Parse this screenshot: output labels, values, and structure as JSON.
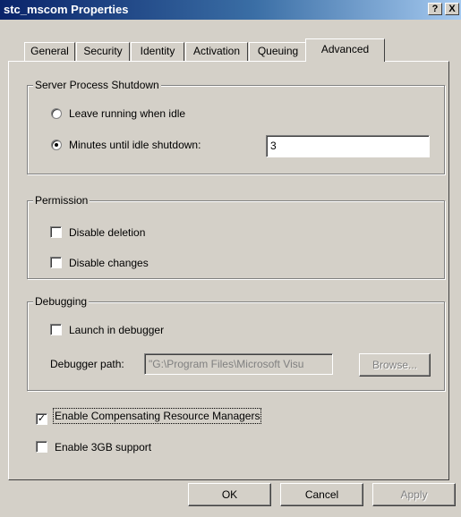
{
  "window": {
    "title": "stc_mscom Properties"
  },
  "titlebar_buttons": {
    "help": "?",
    "close": "X"
  },
  "tabs": [
    {
      "label": "General"
    },
    {
      "label": "Security"
    },
    {
      "label": "Identity"
    },
    {
      "label": "Activation"
    },
    {
      "label": "Queuing"
    },
    {
      "label": "Advanced",
      "active": true
    }
  ],
  "server_shutdown": {
    "legend": "Server Process Shutdown",
    "leave_running_label": "Leave running when idle",
    "minutes_label": "Minutes until idle shutdown:",
    "selected": "minutes",
    "minutes_value": "3"
  },
  "permission": {
    "legend": "Permission",
    "disable_deletion_label": "Disable deletion",
    "disable_changes_label": "Disable changes",
    "disable_deletion_checked": false,
    "disable_changes_checked": false
  },
  "debugging": {
    "legend": "Debugging",
    "launch_label": "Launch in debugger",
    "launch_checked": false,
    "path_label": "Debugger path:",
    "path_value": "\"G:\\Program Files\\Microsoft Visu",
    "browse_label": "Browse..."
  },
  "options": {
    "crm_label": "Enable Compensating Resource Managers",
    "crm_checked": true,
    "three_gb_label": "Enable 3GB support",
    "three_gb_checked": false
  },
  "buttons": {
    "ok": "OK",
    "cancel": "Cancel",
    "apply": "Apply"
  }
}
